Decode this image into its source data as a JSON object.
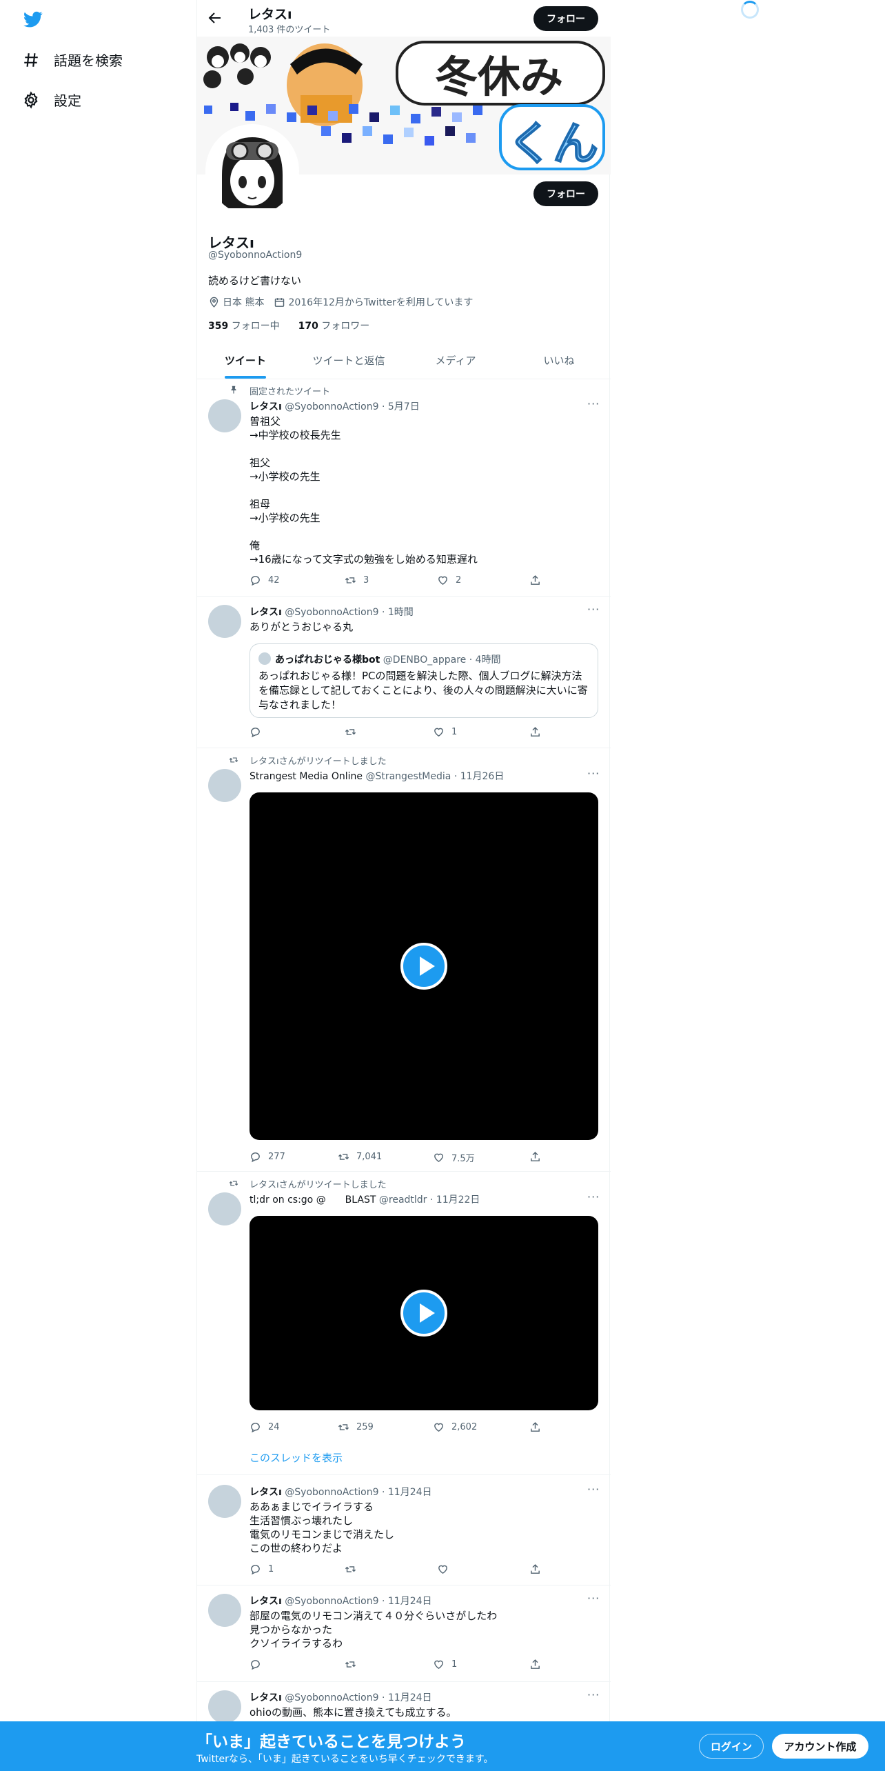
{
  "nav": {
    "explore": "話題を検索",
    "settings": "設定"
  },
  "topbar": {
    "name": "レタスı",
    "tweet_count": "1,403 件のツイート",
    "follow": "フォロー"
  },
  "banner": {
    "text_a": "冬休み",
    "text_b": "くん"
  },
  "profile": {
    "name": "レタスı",
    "handle": "@SyobonnoAction9",
    "bio": "読めるけど書けない",
    "location": "日本 熊本",
    "joined": "2016年12月からTwitterを利用しています",
    "following_count": "359",
    "following_label": "フォロー中",
    "followers_count": "170",
    "followers_label": "フォロワー",
    "follow": "フォロー"
  },
  "tabs": [
    "ツイート",
    "ツイートと返信",
    "メディア",
    "いいね"
  ],
  "tweets": [
    {
      "context": "固定されたツイート",
      "name": "レタスı",
      "handle": "@SyobonnoAction9",
      "time": "· 5月7日",
      "text": "曽祖父\n→中学校の校長先生\n\n祖父\n→小学校の先生\n\n祖母\n→小学校の先生\n\n俺\n→16歳になって文字式の勉強をし始める知恵遅れ",
      "replies": "42",
      "retweets": "3",
      "likes": "2"
    },
    {
      "name": "レタスı",
      "handle": "@SyobonnoAction9",
      "time": "· 1時間",
      "text": "ありがとうおじゃる丸",
      "quote": {
        "name": "あっぱれおじゃる様bot",
        "handle": "@DENBO_appare",
        "time": "· 4時間",
        "text": "あっぱれおじゃる様！PCの問題を解決した際、個人ブログに解決方法を備忘録として記しておくことにより、後の人々の問題解決に大いに寄与なされました！"
      },
      "replies": "",
      "retweets": "",
      "likes": "1"
    },
    {
      "context": "レタスıさんがリツイートしました",
      "name": "Strangest Media Online",
      "handle": "@StrangestMedia",
      "time": "· 11月26日",
      "replies": "277",
      "retweets": "7,041",
      "likes": "7.5万"
    },
    {
      "context": "レタスıさんがリツイートしました",
      "name": "tl;dr on cs:go @　　BLAST",
      "handle": "@readtldr",
      "time": "· 11月22日",
      "replies": "24",
      "retweets": "259",
      "likes": "2,602",
      "thread": "このスレッドを表示"
    },
    {
      "name": "レタスı",
      "handle": "@SyobonnoAction9",
      "time": "· 11月24日",
      "text": "ああぁまじでイライラする\n生活習慣ぶっ壊れたし\n電気のリモコンまじで消えたし\nこの世の終わりだよ",
      "replies": "1",
      "retweets": "",
      "likes": ""
    },
    {
      "name": "レタスı",
      "handle": "@SyobonnoAction9",
      "time": "· 11月24日",
      "text": "部屋の電気のリモコン消えて４０分ぐらいさがしたわ\n見つからなかった\nクソイライラするわ",
      "replies": "",
      "retweets": "",
      "likes": "1"
    },
    {
      "name": "レタスı",
      "handle": "@SyobonnoAction9",
      "time": "· 11月24日",
      "text": "ohioの動画、熊本に置き換えても成立する。"
    }
  ],
  "bottom": {
    "title": "「いま」起きていることを見つけよう",
    "subtitle": "Twitterなら、「いま」起きていることをいち早くチェックできます。",
    "login": "ログイン",
    "signup": "アカウント作成"
  },
  "colors": {
    "accent": "#1d9bf0",
    "text": "#0f1419",
    "muted": "#536471"
  }
}
